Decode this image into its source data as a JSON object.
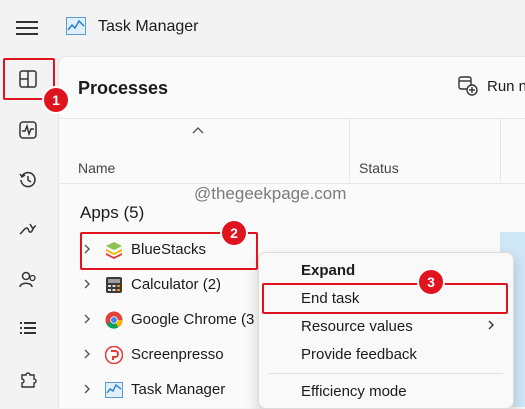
{
  "window": {
    "title": "Task Manager",
    "hamburger_icon": "hamburger-menu-icon",
    "logo_icon": "task-manager-icon"
  },
  "nav": {
    "items": [
      {
        "id": "processes",
        "icon": "processes-icon"
      },
      {
        "id": "performance",
        "icon": "performance-icon"
      },
      {
        "id": "app-history",
        "icon": "history-icon"
      },
      {
        "id": "startup-apps",
        "icon": "startup-icon"
      },
      {
        "id": "users",
        "icon": "users-icon"
      },
      {
        "id": "details",
        "icon": "details-list-icon"
      },
      {
        "id": "services",
        "icon": "services-puzzle-icon"
      }
    ]
  },
  "main": {
    "title": "Processes",
    "run_task_label": "Run n",
    "columns": {
      "name": "Name",
      "status": "Status"
    },
    "group": "Apps (5)",
    "watermark": "@thegeekpage.com",
    "rows": [
      {
        "label": "BlueStacks",
        "icon": "bluestacks-icon"
      },
      {
        "label": "Calculator (2)",
        "icon": "calculator-icon"
      },
      {
        "label": "Google Chrome (3",
        "icon": "chrome-icon"
      },
      {
        "label": "Screenpresso",
        "icon": "screenpresso-icon"
      },
      {
        "label": "Task Manager",
        "icon": "task-manager-icon"
      }
    ]
  },
  "context_menu": {
    "items": [
      "Expand",
      "End task",
      "Resource values",
      "Provide feedback",
      "Efficiency mode"
    ]
  },
  "annotations": {
    "step1": "1",
    "step2": "2",
    "step3": "3"
  },
  "colors": {
    "annotation_red": "#e0141e",
    "menu_bg": "#f9f9f9",
    "window_bg": "#f3f3f3"
  }
}
